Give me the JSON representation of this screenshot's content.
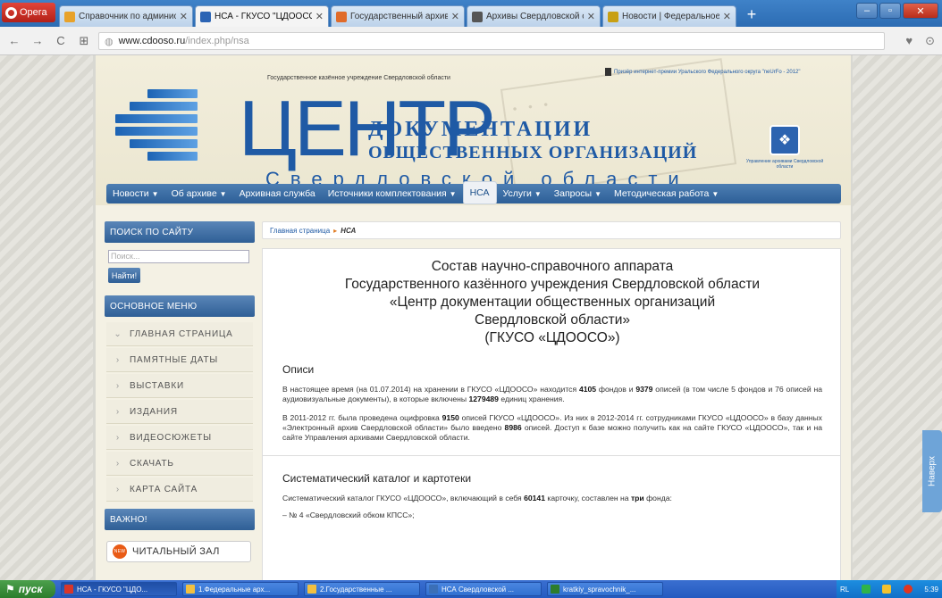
{
  "browser": {
    "menu_label": "Opera",
    "tabs": [
      {
        "title": "Справочник по администр",
        "active": false,
        "favicon_color": "#e8a22a"
      },
      {
        "title": "НСА - ГКУСО \"ЦДООСО\"",
        "active": true,
        "favicon_color": "#2b64b4"
      },
      {
        "title": "Государственный архив с",
        "active": false,
        "favicon_color": "#e06b2a"
      },
      {
        "title": "Архивы Свердловской обл",
        "active": false,
        "favicon_color": "#555555"
      },
      {
        "title": "Новости | Федеральное ар",
        "active": false,
        "favicon_color": "#c8a014"
      }
    ],
    "new_tab": "+",
    "url_domain": "www.cdooso.ru",
    "url_path": "/index.php/nsa"
  },
  "site": {
    "org_type": "Государственное казённое учреждение Свердловской области",
    "big_letter": "ЦЕНТР",
    "title_line1": "ДОКУМЕНТАЦИИ",
    "title_line2": "ОБЩЕСТВЕННЫХ ОРГАНИЗАЦИЙ",
    "region": "Свердловской области",
    "prize_text": "Призёр интернет-премии Уральского Федерального округа \"neUrFo - 2012\"",
    "archive_mgmt": "Управление архивами Свердловской области",
    "menu": [
      {
        "label": "Новости",
        "dropdown": true
      },
      {
        "label": "Об архиве",
        "dropdown": true
      },
      {
        "label": "Архивная служба",
        "dropdown": false
      },
      {
        "label": "Источники комплектования",
        "dropdown": true
      },
      {
        "label": "НСА",
        "dropdown": false,
        "active": true
      },
      {
        "label": "Услуги",
        "dropdown": true
      },
      {
        "label": "Запросы",
        "dropdown": true
      },
      {
        "label": "Методическая работа",
        "dropdown": true
      }
    ]
  },
  "sidebar": {
    "search_heading": "ПОИСК ПО САЙТУ",
    "search_placeholder": "Поиск...",
    "search_button": "Найти!",
    "main_menu_heading": "ОСНОВНОЕ МЕНЮ",
    "main_menu": [
      {
        "label": "ГЛАВНАЯ СТРАНИЦА",
        "chevron": "⌄"
      },
      {
        "label": "ПАМЯТНЫЕ ДАТЫ",
        "chevron": "›"
      },
      {
        "label": "ВЫСТАВКИ",
        "chevron": "›"
      },
      {
        "label": "ИЗДАНИЯ",
        "chevron": "›"
      },
      {
        "label": "ВИДЕОСЮЖЕТЫ",
        "chevron": "›"
      },
      {
        "label": "СКАЧАТЬ",
        "chevron": "›"
      },
      {
        "label": "КАРТА САЙТА",
        "chevron": "›"
      }
    ],
    "important_heading": "ВАЖНО!",
    "reading_room": "ЧИТАЛЬНЫЙ ЗАЛ",
    "new_badge": "NEW"
  },
  "breadcrumb": {
    "home": "Главная страница",
    "separator": "▸",
    "current": "НСА"
  },
  "content": {
    "title": [
      "Состав научно-справочного аппарата",
      "Государственного казённого учреждения Свердловской области",
      "«Центр документации общественных организаций",
      "Свердловской области»",
      "(ГКУСО «ЦДООСО»)"
    ],
    "section1_heading": "Описи",
    "p1_a": "В настоящее время (на 01.07.2014) на хранении в ГКУСО «ЦДООСО» находится ",
    "p1_b": "4105",
    "p1_c": " фондов и ",
    "p1_d": "9379",
    "p1_e": " описей (в том числе 5 фондов и 76 описей на аудиовизуальные документы), в которые включены ",
    "p1_f": "1279489",
    "p1_g": " единиц хранения.",
    "p2_a": "В 2011-2012 гг. была проведена оцифровка ",
    "p2_b": "9150",
    "p2_c": " описей ГКУСО «ЦДООСО». Из них в 2012-2014 гг. сотрудниками ГКУСО «ЦДООСО» в базу данных «Электронный архив Свердловской области» было введено ",
    "p2_d": "8986",
    "p2_e": " описей. Доступ к базе можно получить как на сайте ГКУСО «ЦДООСО», так и на сайте Управления архивами Свердловской области.",
    "section2_heading": "Систематический каталог и картотеки",
    "p3_a": "Систематический каталог ГКУСО «ЦДООСО», включающий в себя ",
    "p3_b": "60141",
    "p3_c": " карточку, составлен на ",
    "p3_d": "три",
    "p3_e": " фонда:",
    "bullet1": "– № 4 «Свердловский обком КПСС»;"
  },
  "feedback_tab": "Наверх",
  "taskbar": {
    "start": "пуск",
    "tasks": [
      {
        "label": "НСА - ГКУСО \"ЦДО...",
        "icon_color": "#d8362a",
        "active": true
      },
      {
        "label": "1.Федеральные арх...",
        "icon_color": "#f3c040",
        "active": false
      },
      {
        "label": "2.Государственные ...",
        "icon_color": "#f3c040",
        "active": false
      },
      {
        "label": "НСА Свердловской ...",
        "icon_color": "#3b6fb7",
        "active": false
      },
      {
        "label": "kratkiy_spravochnik_...",
        "icon_color": "#2d7d2d",
        "active": false
      }
    ],
    "lang": "RL",
    "time": "5:39"
  }
}
